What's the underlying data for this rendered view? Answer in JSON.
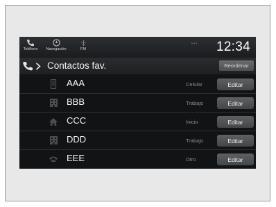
{
  "status_bar": {
    "telefono_label": "Teléfono",
    "navegacion_label": "Navegación",
    "fm_label": "FM",
    "signal_text": "• • •",
    "clock": "12:34"
  },
  "header": {
    "title": "Contactos fav.",
    "reorder_label": "Reordenar"
  },
  "contacts": [
    {
      "name": "AAA",
      "type": "Celular",
      "icon": "mobile-phone-icon",
      "edit_label": "Editar"
    },
    {
      "name": "BBB",
      "type": "Trabajo",
      "icon": "office-building-icon",
      "edit_label": "Editar"
    },
    {
      "name": "CCC",
      "type": "Inicio",
      "icon": "home-icon",
      "edit_label": "Editar"
    },
    {
      "name": "DDD",
      "type": "Trabajo",
      "icon": "office-building-icon",
      "edit_label": "Editar"
    },
    {
      "name": "EEE",
      "type": "Otro",
      "icon": "other-phone-icon",
      "edit_label": "Editar"
    }
  ],
  "colors": {
    "screen_bg": "#121314",
    "button_bg": "#53565a",
    "secondary_text": "#8e8e8e"
  }
}
